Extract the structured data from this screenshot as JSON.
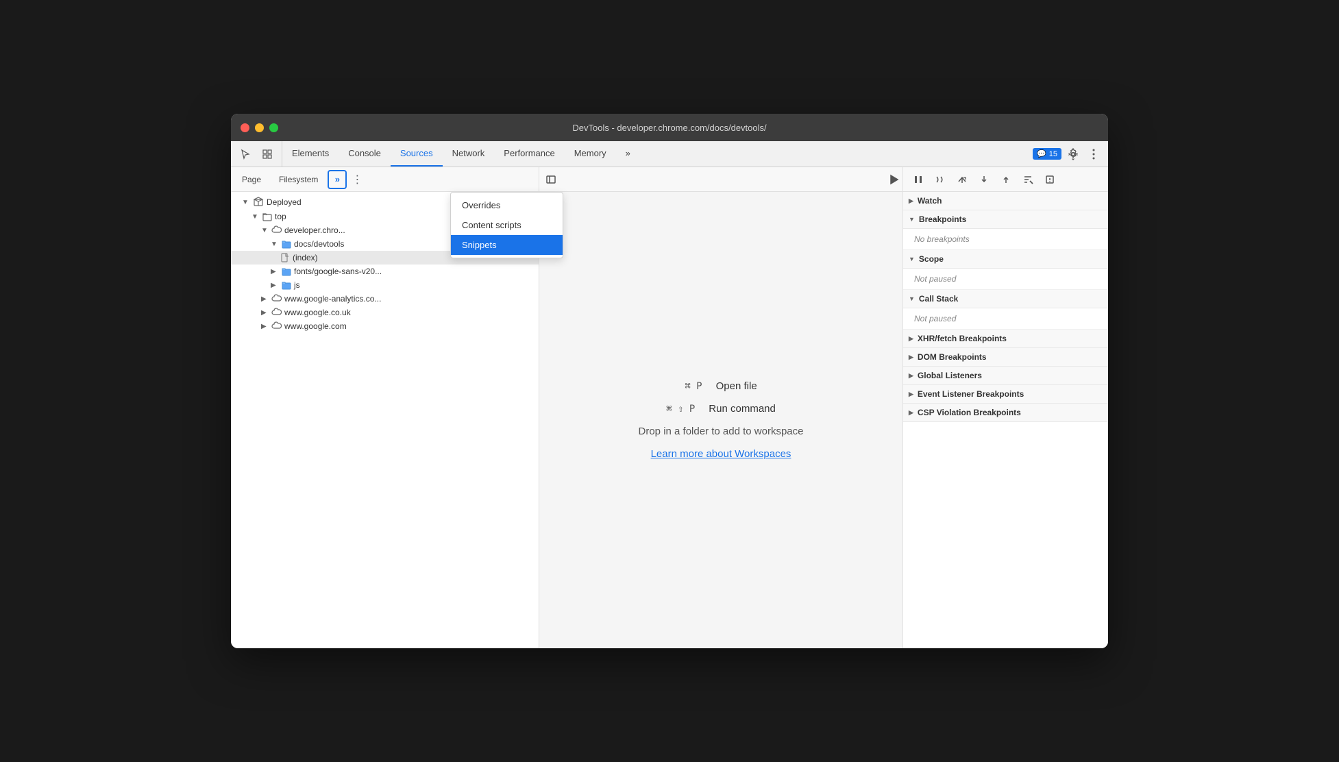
{
  "window": {
    "title": "DevTools - developer.chrome.com/docs/devtools/"
  },
  "tabs": {
    "items": [
      "Elements",
      "Console",
      "Sources",
      "Network",
      "Performance",
      "Memory"
    ],
    "active": "Sources",
    "more_icon": "»",
    "badge_icon": "💬",
    "badge_count": "15"
  },
  "sources_tabs": {
    "items": [
      "Page",
      "Filesystem"
    ],
    "chevron": "»",
    "more_icon": "⋮"
  },
  "dropdown": {
    "items": [
      "Overrides",
      "Content scripts",
      "Snippets"
    ],
    "active": "Snippets"
  },
  "file_tree": {
    "items": [
      {
        "indent": 1,
        "type": "folder",
        "expanded": true,
        "label": "Deployed",
        "icon": "cube"
      },
      {
        "indent": 2,
        "type": "folder",
        "expanded": true,
        "label": "top"
      },
      {
        "indent": 3,
        "type": "cloud",
        "expanded": true,
        "label": "developer.chro..."
      },
      {
        "indent": 4,
        "type": "folder-blue",
        "expanded": true,
        "label": "docs/devtools"
      },
      {
        "indent": 5,
        "type": "file",
        "label": "(index)",
        "selected": true
      },
      {
        "indent": 4,
        "type": "folder-blue",
        "expanded": false,
        "label": "fonts/google-sans-v20..."
      },
      {
        "indent": 4,
        "type": "folder-blue",
        "expanded": false,
        "label": "js"
      },
      {
        "indent": 3,
        "type": "cloud",
        "expanded": false,
        "label": "www.google-analytics.co..."
      },
      {
        "indent": 3,
        "type": "cloud",
        "expanded": false,
        "label": "www.google.co.uk"
      },
      {
        "indent": 3,
        "type": "cloud",
        "expanded": false,
        "label": "www.google.com"
      }
    ]
  },
  "workspace": {
    "shortcut_open": "⌘ P",
    "action_open": "Open file",
    "shortcut_run": "⌘ ⇧ P",
    "action_run": "Run command",
    "drop_text": "Drop in a folder to add to workspace",
    "link_text": "Learn more about Workspaces"
  },
  "debugger": {
    "toolbar_icons": [
      "pause",
      "resume",
      "step-over",
      "step-into",
      "step-out",
      "deactivate",
      "pause-exceptions"
    ],
    "sections": [
      {
        "label": "Watch",
        "collapsed": true
      },
      {
        "label": "Breakpoints",
        "collapsed": false,
        "content": "No breakpoints"
      },
      {
        "label": "Scope",
        "collapsed": false,
        "content": "Not paused"
      },
      {
        "label": "Call Stack",
        "collapsed": false,
        "content": "Not paused"
      },
      {
        "label": "XHR/fetch Breakpoints",
        "collapsed": true
      },
      {
        "label": "DOM Breakpoints",
        "collapsed": true
      },
      {
        "label": "Global Listeners",
        "collapsed": true
      },
      {
        "label": "Event Listener Breakpoints",
        "collapsed": true
      },
      {
        "label": "CSP Violation Breakpoints",
        "collapsed": true
      }
    ]
  },
  "colors": {
    "active_tab_color": "#1a73e8",
    "selected_dropdown_bg": "#1a73e8",
    "link_color": "#1a73e8"
  }
}
